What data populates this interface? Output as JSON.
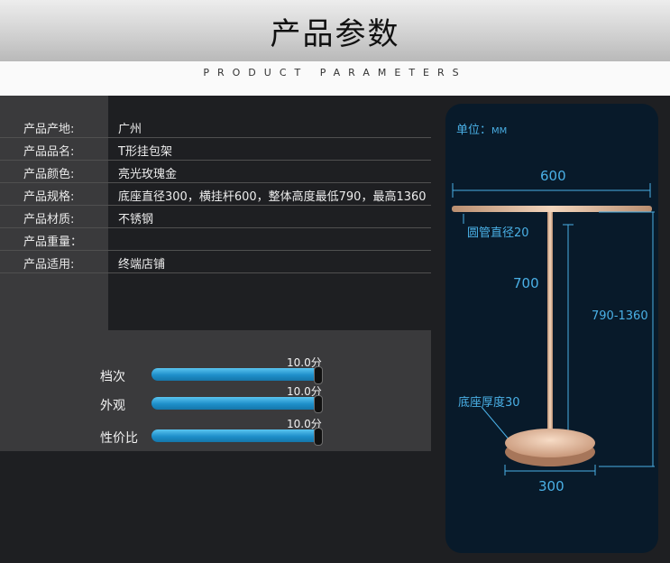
{
  "header": {
    "title": "产品参数",
    "subtitle": "PRODUCT PARAMETERS"
  },
  "specs": [
    {
      "label": "产品产地:",
      "value": "广州"
    },
    {
      "label": "产品品名:",
      "value": "T形挂包架"
    },
    {
      "label": "产品颜色:",
      "value": "亮光玫瑰金"
    },
    {
      "label": "产品规格:",
      "value": "底座直径300，横挂杆600，整体高度最低790，最高1360"
    },
    {
      "label": "产品材质:",
      "value": "不锈钢"
    },
    {
      "label": "产品重量：",
      "value": ""
    },
    {
      "label": "产品适用:",
      "value": "终端店铺"
    }
  ],
  "ratings": [
    {
      "name": "档次",
      "score": "10.0分",
      "level": 1.0
    },
    {
      "name": "外观",
      "score": "10.0分",
      "level": 1.0
    },
    {
      "name": "性价比",
      "score": "10.0分",
      "level": 1.0
    }
  ],
  "diagram": {
    "unit_label": "单位：",
    "unit_value": "MM",
    "width_top": "600",
    "tube": "圆管直径20",
    "pole_height": "700",
    "total_height": "790-1360",
    "base_thickness": "底座厚度30",
    "base_diameter": "300"
  },
  "colors": {
    "accent": "#4ab0e6",
    "bar_fill": "#1e8fca",
    "rose_gold": "#e4bfa0",
    "panel_bg": "#3a3a3c",
    "diagram_bg": "#081a2a"
  }
}
